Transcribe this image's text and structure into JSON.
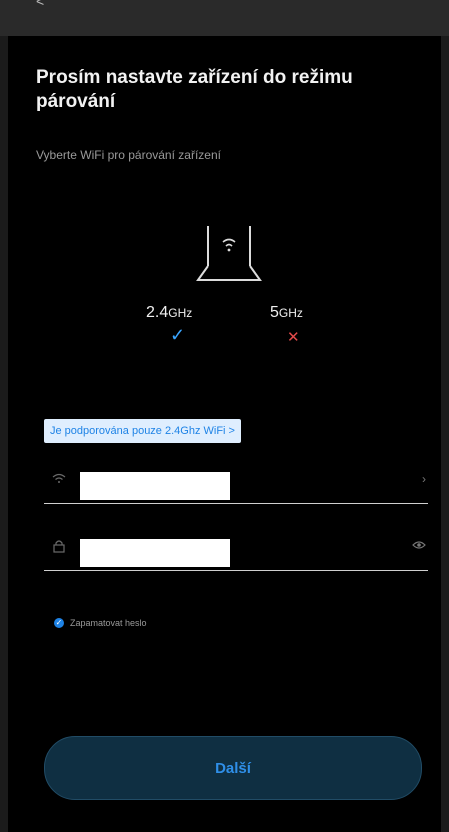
{
  "header": {
    "back_label": "<"
  },
  "title": "Prosím nastavte zařízení do režimu párování",
  "subtitle": "Vyberte WiFi pro párování zařízení",
  "bands": {
    "band_24": {
      "value": "2.4",
      "unit": "GHz",
      "status_icon": "check-icon",
      "supported": true
    },
    "band_5": {
      "value": "5",
      "unit": "GHz",
      "status_icon": "cross-icon",
      "supported": false
    }
  },
  "notice": {
    "label": "Je podporována pouze 2.4Ghz WiFi >"
  },
  "ssid_field": {
    "icon": "wifi-icon",
    "value": "",
    "right_icon": "chevron-right-icon"
  },
  "password_field": {
    "icon": "lock-icon",
    "value": "",
    "right_icon": "eye-icon"
  },
  "remember_label": "Zapamatovat heslo",
  "remember_checked": true,
  "next_button": {
    "label": "Další"
  },
  "colors": {
    "accent": "#1e83e6",
    "cross": "#e34a4a",
    "background": "#000000"
  }
}
